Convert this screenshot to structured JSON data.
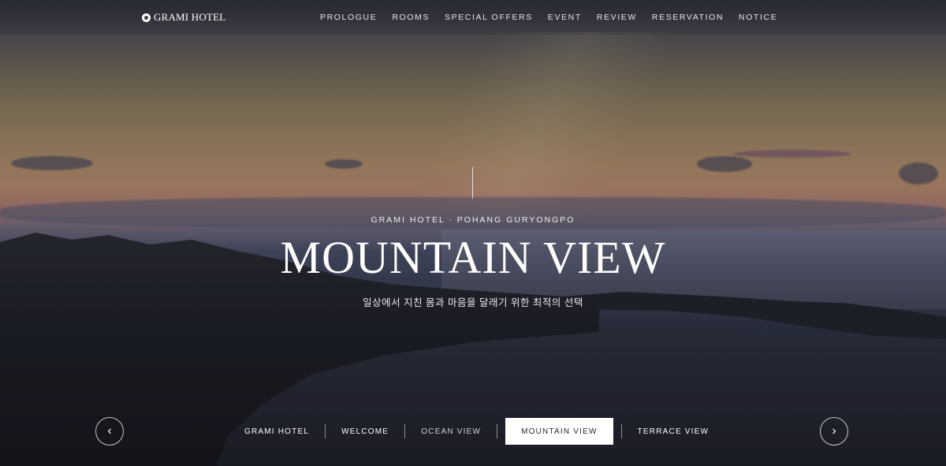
{
  "brand": {
    "name": "GRAMI HOTEL"
  },
  "nav": {
    "items": [
      "PROLOGUE",
      "ROOMS",
      "SPECIAL OFFERS",
      "EVENT",
      "REVIEW",
      "RESERVATION",
      "NOTICE"
    ]
  },
  "hero": {
    "subtitle": "GRAMI HOTEL · POHANG GURYONGPO",
    "title": "MOUNTAIN VIEW",
    "tagline": "일상에서 지친 몸과 마음을 달래기 위한 최적의 선택"
  },
  "slider": {
    "prev_icon": "chevron-left-icon",
    "next_icon": "chevron-right-icon",
    "prev_glyph": "‹",
    "next_glyph": "›",
    "tabs": [
      "GRAMI HOTEL",
      "WELCOME",
      "OCEAN VIEW",
      "MOUNTAIN VIEW",
      "TERRACE VIEW"
    ],
    "active": "MOUNTAIN VIEW"
  },
  "colors": {
    "active_tab_bg": "#ffffff",
    "active_tab_text": "#2c2c34",
    "text": "#ffffff"
  }
}
